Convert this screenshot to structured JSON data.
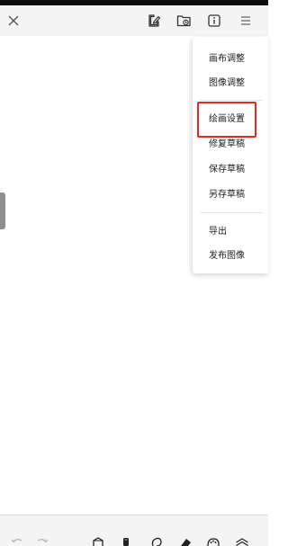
{
  "toolbar": {
    "icons": [
      "close-icon",
      "edit-canvas-icon",
      "folder-icon",
      "info-icon",
      "menu-icon"
    ]
  },
  "menu": {
    "items": [
      {
        "label": "画布调整"
      },
      {
        "label": "图像调整"
      },
      {
        "label": "绘画设置",
        "highlighted": true
      },
      {
        "label": "修复草稿"
      },
      {
        "label": "保存草稿"
      },
      {
        "label": "另存草稿"
      },
      {
        "label": "导出"
      },
      {
        "label": "发布图像"
      }
    ],
    "highlight_color": "#e8291e"
  },
  "bottom_toolbar": {
    "icons": [
      "undo-icon",
      "redo-icon",
      "transform-icon",
      "brush-icon",
      "lasso-icon",
      "eraser-icon",
      "palette-icon",
      "layers-icon"
    ]
  },
  "colors": {
    "toolbar_bg": "#f4f4f4",
    "status_bar": "#0d0d0d",
    "canvas": "#ffffff"
  }
}
